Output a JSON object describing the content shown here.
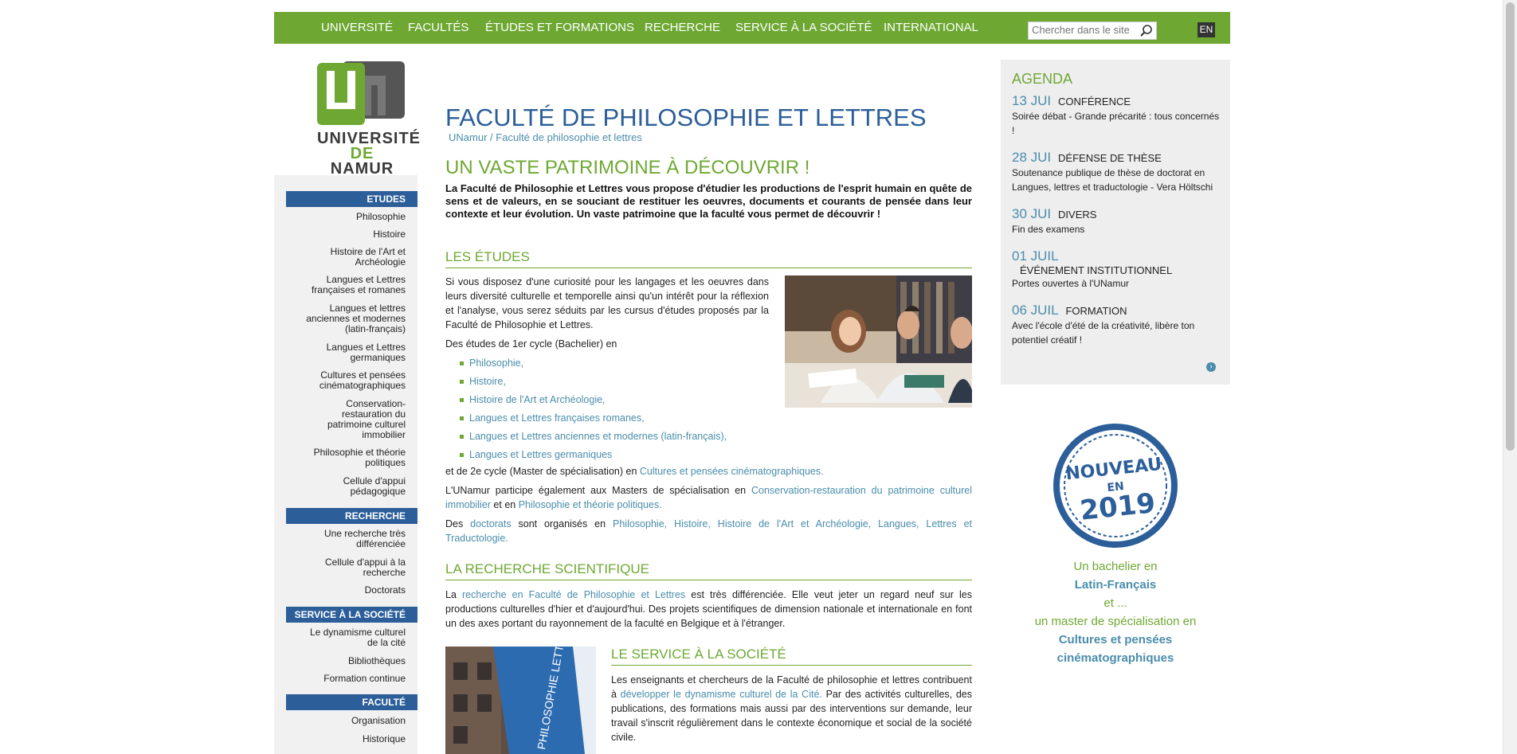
{
  "topnav": {
    "items": [
      "UNIVERSITÉ",
      "FACULTÉS",
      "ÉTUDES ET FORMATIONS",
      "RECHERCHE",
      "SERVICE À LA SOCIÉTÉ",
      "INTERNATIONAL"
    ],
    "search_placeholder": "Chercher dans le site",
    "lang": "EN"
  },
  "logo": {
    "line1": "UNIVERSITÉ",
    "line2_a": "DE",
    "line2_b": "NAMUR"
  },
  "sidebar": {
    "sections": [
      {
        "header": "ETUDES",
        "links": [
          "Philosophie",
          "Histoire",
          "Histoire de l'Art et Archéologie",
          "Langues et Lettres françaises et romanes",
          "Langues et lettres anciennes et modernes (latin-français)",
          "Langues et Lettres germaniques",
          "Cultures et pensées cinématographiques",
          "Conservation-restauration du patrimoine culturel immobilier",
          "Philosophie et théorie politiques",
          "Cellule d'appui pédagogique"
        ]
      },
      {
        "header": "RECHERCHE",
        "links": [
          "Une recherche très différenciée",
          "Cellule d'appui à la recherche",
          "Doctorats"
        ]
      },
      {
        "header": "SERVICE À LA SOCIÉTÉ",
        "links": [
          "Le dynamisme culturel de la cité",
          "Bibliothèques",
          "Formation continue"
        ]
      },
      {
        "header": "FACULTÉ",
        "links": [
          "Organisation",
          "Historique"
        ]
      }
    ]
  },
  "main": {
    "title": "FACULTÉ DE PHILOSOPHIE ET LETTRES",
    "breadcrumb": [
      "UNamur",
      "/",
      "Faculté de philosophie et lettres"
    ],
    "lead_title": "UN VASTE PATRIMOINE À DÉCOUVRIR !",
    "intro": "La Faculté de Philosophie et Lettres vous propose d'étudier les productions de l'esprit humain en quête de sens et de valeurs, en se souciant de restituer les oeuvres, documents et courants de pensée dans leur contexte et leur évolution. Un vaste patrimoine que la faculté vous permet de découvrir !",
    "etudes": {
      "title": "LES ÉTUDES",
      "p1": "Si vous disposez d'une curiosité pour les langages et les oeuvres dans leurs diversité culturelle et temporelle ainsi qu'un intérêt pour la réflexion et l'analyse, vous serez séduits par les cursus d'études proposés par la Faculté de Philosophie et Lettres.",
      "p2": "Des études de 1er cycle (Bachelier) en",
      "bachelors": [
        "Philosophie,",
        "Histoire,",
        "Histoire de l'Art et Archéologie,",
        "Langues et Lettres françaises romanes,",
        "Langues et Lettres anciennes et modernes (latin-français),",
        "Langues et Lettres germaniques"
      ],
      "p3_a": "et de 2e cycle (Master de spécialisation) en ",
      "p3_link": "Cultures et pensées cinématographiques.",
      "p4_a": "L'UNamur participe également aux Masters de spécialisation en ",
      "p4_link1": "Conservation-restauration du patrimoine culturel immobilier",
      "p4_b": " et en ",
      "p4_link2": "Philosophie et théorie politiques.",
      "p5_a": "Des ",
      "p5_link1": "doctorats",
      "p5_b": " sont organisés en ",
      "p5_link2": "Philosophie, Histoire, Histoire de l'Art et Archéologie, Langues, Lettres et Traductologie."
    },
    "recherche": {
      "title": "LA RECHERCHE SCIENTIFIQUE",
      "p_a": "La ",
      "p_link": "recherche en Faculté de Philosophie et Lettres",
      "p_b": " est très différenciée. Elle veut jeter un regard neuf sur les productions culturelles d'hier et d'aujourd'hui. Des projets scientifiques de dimension nationale et internationale en font un des axes portant du rayonnement de la faculté en Belgique et à l'étranger."
    },
    "service": {
      "title": "LE SERVICE À LA SOCIÉTÉ",
      "p_a": "Les enseignants et chercheurs de la Faculté de philosophie et lettres contribuent à ",
      "p_link": "développer le dynamisme culturel de la Cité.",
      "p_b": " Par des activités culturelles, des publications, des formations mais aussi par des interventions sur demande, leur travail s'inscrit régulièrement dans le contexte économique et social de la société civile.",
      "banner_text": "PHILOSOPHIE LETTRES"
    }
  },
  "agenda": {
    "title": "AGENDA",
    "events": [
      {
        "date": "13 JUI",
        "cat": "CONFÉRENCE",
        "desc": "Soirée débat - Grande précarité : tous concernés !"
      },
      {
        "date": "28 JUI",
        "cat": "DÉFENSE DE THÈSE",
        "desc": "Soutenance publique de thèse de doctorat en Langues, lettres et traductologie - Vera Höltschi"
      },
      {
        "date": "30 JUI",
        "cat": "DIVERS",
        "desc": "Fin des examens"
      },
      {
        "date": "01 JUIL",
        "cat": "ÉVÉNEMENT INSTITUTIONNEL",
        "desc": "Portes ouvertes à l'UNamur"
      },
      {
        "date": "06 JUIL",
        "cat": "FORMATION",
        "desc": "Avec l'école d'été de la créativité, libère ton potentiel créatif !"
      }
    ],
    "more_icon": "chevron-right-icon"
  },
  "promo": {
    "stamp_line1": "NOUVEAU",
    "stamp_line2": "EN",
    "stamp_line3": "2019",
    "line1": "Un bachelier en",
    "line2": "Latin-Français",
    "line3": "et ...",
    "line4": "un master de spécialisation en",
    "line5": "Cultures et pensées cinématographiques"
  },
  "colors": {
    "green": "#6ea833",
    "blue": "#2c5e99",
    "link": "#4a8dab"
  }
}
